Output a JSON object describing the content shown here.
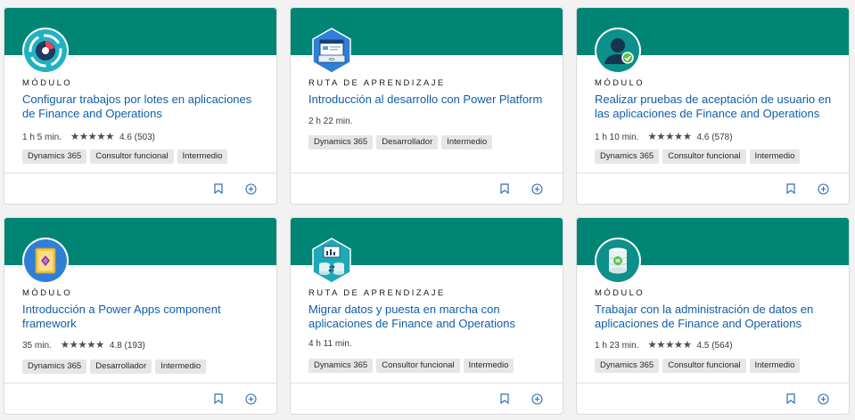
{
  "colors": {
    "band": "#008575",
    "title_link": "#0f5ea8",
    "tag_bg": "#e6e6e6",
    "page_bg": "#f2f2f2"
  },
  "cards": [
    {
      "type": "MÓDULO",
      "title": "Configurar trabajos por lotes en aplicaciones de Finance and Operations",
      "duration": "1 h 5 min.",
      "stars": "★★★★★",
      "rating": "4.6 (503)",
      "tags": [
        "Dynamics 365",
        "Consultor funcional",
        "Intermedio"
      ],
      "icon": "batch-jobs-icon"
    },
    {
      "type": "RUTA DE APRENDIZAJE",
      "title": "Introducción al desarrollo con Power Platform",
      "duration": "2 h 22 min.",
      "stars": "",
      "rating": "",
      "tags": [
        "Dynamics 365",
        "Desarrollador",
        "Intermedio"
      ],
      "icon": "development-window-icon"
    },
    {
      "type": "MÓDULO",
      "title": "Realizar pruebas de aceptación de usuario en las aplicaciones de Finance and Operations",
      "duration": "1 h 10 min.",
      "stars": "★★★★★",
      "rating": "4.6 (578)",
      "tags": [
        "Dynamics 365",
        "Consultor funcional",
        "Intermedio"
      ],
      "icon": "user-check-icon"
    },
    {
      "type": "MÓDULO",
      "title": "Introducción a Power Apps component framework",
      "duration": "35 min.",
      "stars": "★★★★★",
      "rating": "4.8 (193)",
      "tags": [
        "Dynamics 365",
        "Desarrollador",
        "Intermedio"
      ],
      "icon": "power-apps-icon"
    },
    {
      "type": "RUTA DE APRENDIZAJE",
      "title": "Migrar datos y puesta en marcha con aplicaciones de Finance and Operations",
      "duration": "4 h 11 min.",
      "stars": "",
      "rating": "",
      "tags": [
        "Dynamics 365",
        "Consultor funcional",
        "Intermedio"
      ],
      "icon": "data-migration-icon"
    },
    {
      "type": "MÓDULO",
      "title": "Trabajar con la administración de datos en aplicaciones de Finance and Operations",
      "duration": "1 h 23 min.",
      "stars": "★★★★★",
      "rating": "4.5 (564)",
      "tags": [
        "Dynamics 365",
        "Consultor funcional",
        "Intermedio"
      ],
      "icon": "database-icon"
    }
  ]
}
